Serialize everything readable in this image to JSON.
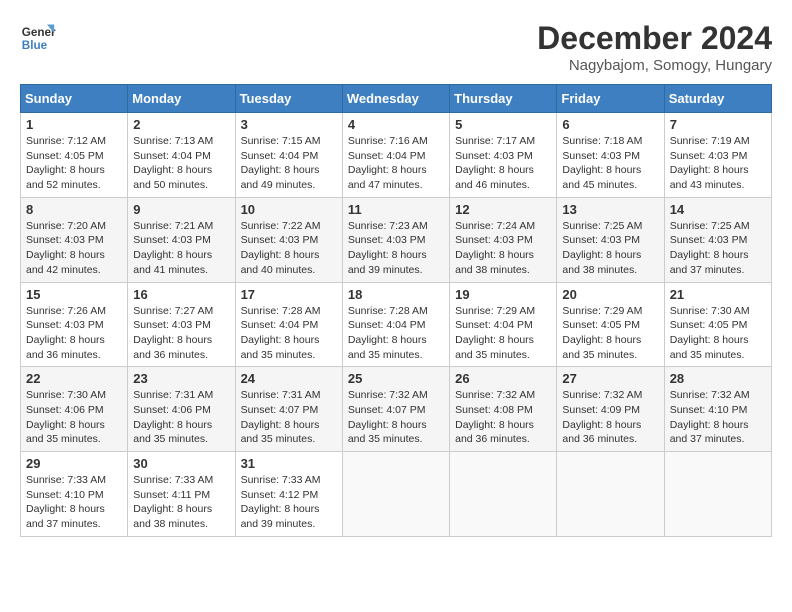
{
  "logo": {
    "text_line1": "General",
    "text_line2": "Blue"
  },
  "title": "December 2024",
  "subtitle": "Nagybajom, Somogy, Hungary",
  "days_of_week": [
    "Sunday",
    "Monday",
    "Tuesday",
    "Wednesday",
    "Thursday",
    "Friday",
    "Saturday"
  ],
  "weeks": [
    [
      {
        "day": "1",
        "sunrise": "7:12 AM",
        "sunset": "4:05 PM",
        "daylight": "8 hours and 52 minutes."
      },
      {
        "day": "2",
        "sunrise": "7:13 AM",
        "sunset": "4:04 PM",
        "daylight": "8 hours and 50 minutes."
      },
      {
        "day": "3",
        "sunrise": "7:15 AM",
        "sunset": "4:04 PM",
        "daylight": "8 hours and 49 minutes."
      },
      {
        "day": "4",
        "sunrise": "7:16 AM",
        "sunset": "4:04 PM",
        "daylight": "8 hours and 47 minutes."
      },
      {
        "day": "5",
        "sunrise": "7:17 AM",
        "sunset": "4:03 PM",
        "daylight": "8 hours and 46 minutes."
      },
      {
        "day": "6",
        "sunrise": "7:18 AM",
        "sunset": "4:03 PM",
        "daylight": "8 hours and 45 minutes."
      },
      {
        "day": "7",
        "sunrise": "7:19 AM",
        "sunset": "4:03 PM",
        "daylight": "8 hours and 43 minutes."
      }
    ],
    [
      {
        "day": "8",
        "sunrise": "7:20 AM",
        "sunset": "4:03 PM",
        "daylight": "8 hours and 42 minutes."
      },
      {
        "day": "9",
        "sunrise": "7:21 AM",
        "sunset": "4:03 PM",
        "daylight": "8 hours and 41 minutes."
      },
      {
        "day": "10",
        "sunrise": "7:22 AM",
        "sunset": "4:03 PM",
        "daylight": "8 hours and 40 minutes."
      },
      {
        "day": "11",
        "sunrise": "7:23 AM",
        "sunset": "4:03 PM",
        "daylight": "8 hours and 39 minutes."
      },
      {
        "day": "12",
        "sunrise": "7:24 AM",
        "sunset": "4:03 PM",
        "daylight": "8 hours and 38 minutes."
      },
      {
        "day": "13",
        "sunrise": "7:25 AM",
        "sunset": "4:03 PM",
        "daylight": "8 hours and 38 minutes."
      },
      {
        "day": "14",
        "sunrise": "7:25 AM",
        "sunset": "4:03 PM",
        "daylight": "8 hours and 37 minutes."
      }
    ],
    [
      {
        "day": "15",
        "sunrise": "7:26 AM",
        "sunset": "4:03 PM",
        "daylight": "8 hours and 36 minutes."
      },
      {
        "day": "16",
        "sunrise": "7:27 AM",
        "sunset": "4:03 PM",
        "daylight": "8 hours and 36 minutes."
      },
      {
        "day": "17",
        "sunrise": "7:28 AM",
        "sunset": "4:04 PM",
        "daylight": "8 hours and 35 minutes."
      },
      {
        "day": "18",
        "sunrise": "7:28 AM",
        "sunset": "4:04 PM",
        "daylight": "8 hours and 35 minutes."
      },
      {
        "day": "19",
        "sunrise": "7:29 AM",
        "sunset": "4:04 PM",
        "daylight": "8 hours and 35 minutes."
      },
      {
        "day": "20",
        "sunrise": "7:29 AM",
        "sunset": "4:05 PM",
        "daylight": "8 hours and 35 minutes."
      },
      {
        "day": "21",
        "sunrise": "7:30 AM",
        "sunset": "4:05 PM",
        "daylight": "8 hours and 35 minutes."
      }
    ],
    [
      {
        "day": "22",
        "sunrise": "7:30 AM",
        "sunset": "4:06 PM",
        "daylight": "8 hours and 35 minutes."
      },
      {
        "day": "23",
        "sunrise": "7:31 AM",
        "sunset": "4:06 PM",
        "daylight": "8 hours and 35 minutes."
      },
      {
        "day": "24",
        "sunrise": "7:31 AM",
        "sunset": "4:07 PM",
        "daylight": "8 hours and 35 minutes."
      },
      {
        "day": "25",
        "sunrise": "7:32 AM",
        "sunset": "4:07 PM",
        "daylight": "8 hours and 35 minutes."
      },
      {
        "day": "26",
        "sunrise": "7:32 AM",
        "sunset": "4:08 PM",
        "daylight": "8 hours and 36 minutes."
      },
      {
        "day": "27",
        "sunrise": "7:32 AM",
        "sunset": "4:09 PM",
        "daylight": "8 hours and 36 minutes."
      },
      {
        "day": "28",
        "sunrise": "7:32 AM",
        "sunset": "4:10 PM",
        "daylight": "8 hours and 37 minutes."
      }
    ],
    [
      {
        "day": "29",
        "sunrise": "7:33 AM",
        "sunset": "4:10 PM",
        "daylight": "8 hours and 37 minutes."
      },
      {
        "day": "30",
        "sunrise": "7:33 AM",
        "sunset": "4:11 PM",
        "daylight": "8 hours and 38 minutes."
      },
      {
        "day": "31",
        "sunrise": "7:33 AM",
        "sunset": "4:12 PM",
        "daylight": "8 hours and 39 minutes."
      },
      null,
      null,
      null,
      null
    ]
  ]
}
